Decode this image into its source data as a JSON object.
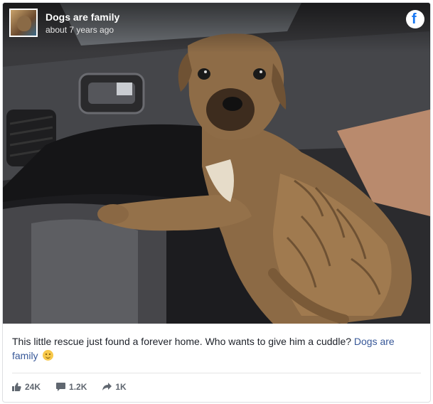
{
  "post": {
    "page_name": "Dogs are family",
    "time": "about 7 years ago",
    "caption_text": "This little rescue just found a forever home. Who wants to give him a cuddle? ",
    "caption_link": "Dogs are family",
    "emoji": "smiling-face-emoji"
  },
  "stats": {
    "likes": "24K",
    "comments": "1.2K",
    "shares": "1K"
  },
  "icons": {
    "brand": "facebook-icon",
    "like": "thumbs-up-icon",
    "comment": "comment-bubble-icon",
    "share": "share-arrow-icon"
  },
  "colors": {
    "link": "#385898",
    "facebook_brand": "#1877f2",
    "stat_text": "#606770"
  }
}
